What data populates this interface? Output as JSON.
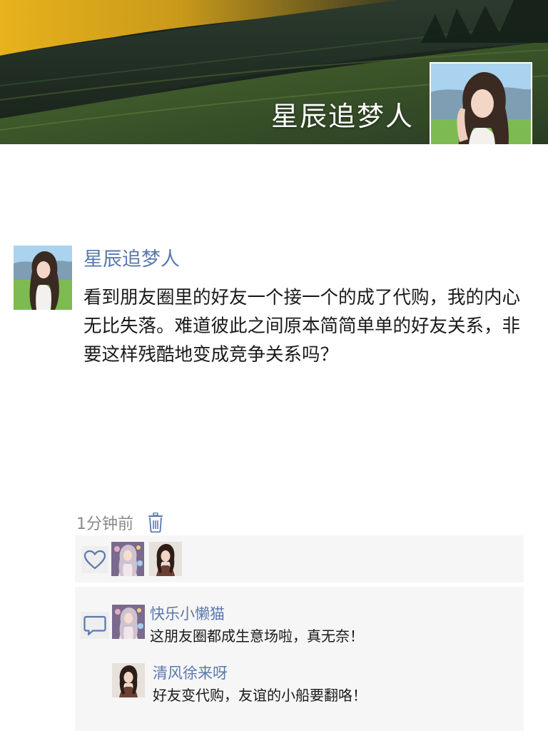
{
  "profile": {
    "cover_name": "星辰追梦人"
  },
  "post": {
    "author": "星辰追梦人",
    "text": "看到朋友圈里的好友一个接一个的成了代购，我的内心无比失落。难道彼此之间原本简简单单的好友关系，非要这样残酷地变成竞争关系吗？",
    "time": "1分钟前"
  },
  "comments": [
    {
      "user": "快乐小懒猫",
      "text": "这朋友圈都成生意场啦，真无奈！"
    },
    {
      "user": "清风徐来呀",
      "text": "好友变代购，友谊的小船要翻咯！"
    }
  ],
  "colors": {
    "accent": "#5a78ad",
    "panel_bg": "#f6f6f6"
  },
  "icons": [
    "heart-icon",
    "comment-icon",
    "trash-icon"
  ]
}
